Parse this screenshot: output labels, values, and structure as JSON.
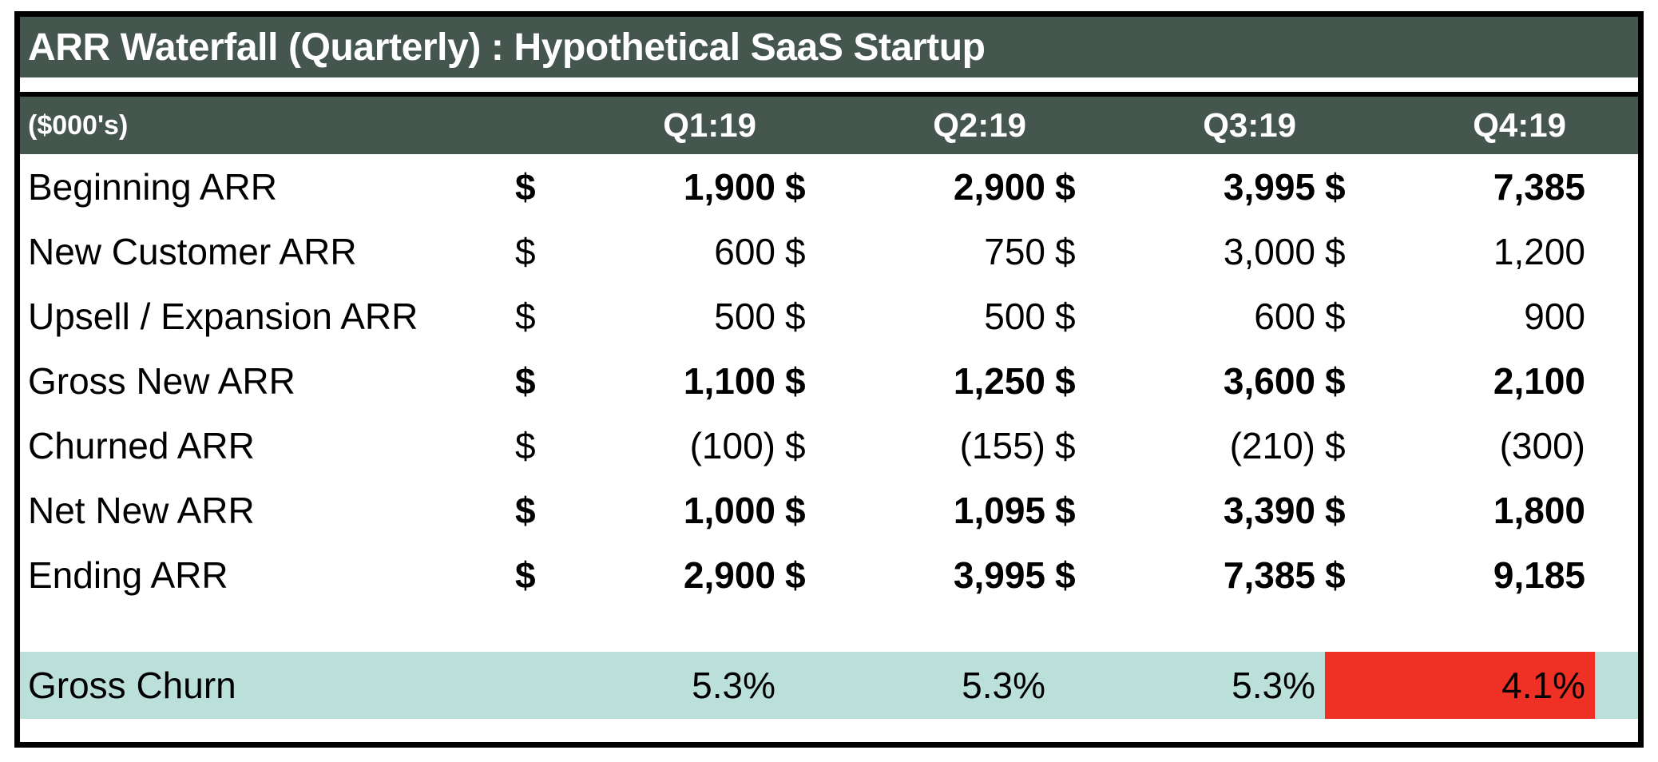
{
  "title": "ARR Waterfall (Quarterly) : Hypothetical SaaS Startup",
  "colors": {
    "header_bg": "#45564F",
    "header_text": "#FFFFFF",
    "footer_bg": "#BBE0DA",
    "alert_bg": "#EE3124",
    "border": "#000000"
  },
  "header": {
    "units_label": "($000's)",
    "columns": [
      "Q1:19",
      "Q2:19",
      "Q3:19",
      "Q4:19"
    ]
  },
  "currency_symbol": "$",
  "rows": [
    {
      "label": "Beginning ARR",
      "bold": true,
      "values": [
        "1,900",
        "2,900",
        "3,995",
        "7,385"
      ]
    },
    {
      "label": "New Customer ARR",
      "bold": false,
      "values": [
        "600",
        "750",
        "3,000",
        "1,200"
      ]
    },
    {
      "label": "Upsell / Expansion ARR",
      "bold": false,
      "values": [
        "500",
        "500",
        "600",
        "900"
      ]
    },
    {
      "label": "Gross New ARR",
      "bold": true,
      "values": [
        "1,100",
        "1,250",
        "3,600",
        "2,100"
      ]
    },
    {
      "label": "Churned ARR",
      "bold": false,
      "values": [
        "(100)",
        "(155)",
        "(210)",
        "(300)"
      ]
    },
    {
      "label": "Net New ARR",
      "bold": true,
      "values": [
        "1,000",
        "1,095",
        "3,390",
        "1,800"
      ]
    },
    {
      "label": "Ending ARR",
      "bold": true,
      "values": [
        "2,900",
        "3,995",
        "7,385",
        "9,185"
      ]
    }
  ],
  "footer": {
    "label": "Gross Churn",
    "values": [
      "5.3%",
      "5.3%",
      "5.3%",
      "4.1%"
    ],
    "alert_index": 3
  },
  "chart_data": {
    "type": "table",
    "title": "ARR Waterfall (Quarterly) : Hypothetical SaaS Startup",
    "units": "($000's)",
    "categories": [
      "Q1:19",
      "Q2:19",
      "Q3:19",
      "Q4:19"
    ],
    "series": [
      {
        "name": "Beginning ARR",
        "values": [
          1900,
          2900,
          3995,
          7385
        ]
      },
      {
        "name": "New Customer ARR",
        "values": [
          600,
          750,
          3000,
          1200
        ]
      },
      {
        "name": "Upsell / Expansion ARR",
        "values": [
          500,
          500,
          600,
          900
        ]
      },
      {
        "name": "Gross New ARR",
        "values": [
          1100,
          1250,
          3600,
          2100
        ]
      },
      {
        "name": "Churned ARR",
        "values": [
          -100,
          -155,
          -210,
          -300
        ]
      },
      {
        "name": "Net New ARR",
        "values": [
          1000,
          1095,
          3390,
          1800
        ]
      },
      {
        "name": "Ending ARR",
        "values": [
          2900,
          3995,
          7385,
          9185
        ]
      },
      {
        "name": "Gross Churn",
        "values": [
          5.3,
          5.3,
          5.3,
          4.1
        ]
      }
    ],
    "xlabel": "",
    "ylabel": "",
    "grid": false,
    "legend": "none"
  }
}
